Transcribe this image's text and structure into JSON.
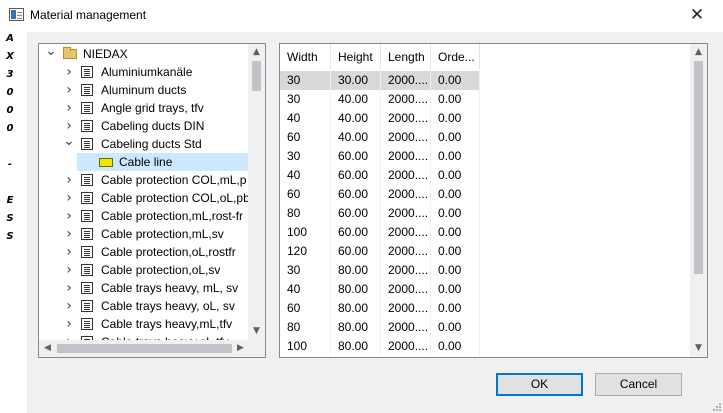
{
  "window": {
    "title": "Material management",
    "close_glyph": "✕",
    "title_icon": "window-app-icon"
  },
  "side_strip": {
    "chars": [
      "A",
      "X",
      "3",
      "0",
      "0",
      "0",
      "",
      "-",
      "",
      "E",
      "S",
      "S"
    ]
  },
  "tree": {
    "items": [
      {
        "label": "NIEDAX",
        "level": 0,
        "expander": "v",
        "icon": "folder-icon"
      },
      {
        "label": "Aluminiumkanäle",
        "level": 1,
        "expander": ">",
        "icon": "document-list-icon"
      },
      {
        "label": "Aluminum ducts",
        "level": 1,
        "expander": ">",
        "icon": "document-list-icon"
      },
      {
        "label": "Angle grid trays, tfv",
        "level": 1,
        "expander": ">",
        "icon": "document-list-icon"
      },
      {
        "label": "Cabeling ducts DIN",
        "level": 1,
        "expander": ">",
        "icon": "document-list-icon"
      },
      {
        "label": "Cabeling ducts Std",
        "level": 1,
        "expander": "v",
        "icon": "document-list-icon"
      },
      {
        "label": "Cable line",
        "level": 2,
        "expander": "",
        "icon": "cable-line-icon",
        "selected": true
      },
      {
        "label": "Cable protection COL,mL,p",
        "level": 1,
        "expander": ">",
        "icon": "document-list-icon"
      },
      {
        "label": "Cable protection COL,oL,pb",
        "level": 1,
        "expander": ">",
        "icon": "document-list-icon"
      },
      {
        "label": "Cable protection,mL,rost-fr",
        "level": 1,
        "expander": ">",
        "icon": "document-list-icon"
      },
      {
        "label": "Cable protection,mL,sv",
        "level": 1,
        "expander": ">",
        "icon": "document-list-icon"
      },
      {
        "label": "Cable protection,oL,rostfr",
        "level": 1,
        "expander": ">",
        "icon": "document-list-icon"
      },
      {
        "label": "Cable protection,oL,sv",
        "level": 1,
        "expander": ">",
        "icon": "document-list-icon"
      },
      {
        "label": "Cable trays heavy, mL, sv",
        "level": 1,
        "expander": ">",
        "icon": "document-list-icon"
      },
      {
        "label": "Cable trays heavy, oL, sv",
        "level": 1,
        "expander": ">",
        "icon": "document-list-icon"
      },
      {
        "label": "Cable trays heavy,mL,tfv",
        "level": 1,
        "expander": ">",
        "icon": "document-list-icon"
      },
      {
        "label": "Cable trays heavy,oL,tfv",
        "level": 1,
        "expander": ">",
        "icon": "document-list-icon"
      }
    ],
    "scroll_up": "▲",
    "scroll_down": "▼",
    "scroll_left": "◀",
    "scroll_right": "▶"
  },
  "grid": {
    "columns": [
      "Width",
      "Height",
      "Length",
      "Orde..."
    ],
    "rows": [
      [
        "30",
        "30.00",
        "2000....",
        "0.00"
      ],
      [
        "30",
        "40.00",
        "2000....",
        "0.00"
      ],
      [
        "40",
        "40.00",
        "2000....",
        "0.00"
      ],
      [
        "60",
        "40.00",
        "2000....",
        "0.00"
      ],
      [
        "30",
        "60.00",
        "2000....",
        "0.00"
      ],
      [
        "40",
        "60.00",
        "2000....",
        "0.00"
      ],
      [
        "60",
        "60.00",
        "2000....",
        "0.00"
      ],
      [
        "80",
        "60.00",
        "2000....",
        "0.00"
      ],
      [
        "100",
        "60.00",
        "2000....",
        "0.00"
      ],
      [
        "120",
        "60.00",
        "2000....",
        "0.00"
      ],
      [
        "30",
        "80.00",
        "2000....",
        "0.00"
      ],
      [
        "40",
        "80.00",
        "2000....",
        "0.00"
      ],
      [
        "60",
        "80.00",
        "2000....",
        "0.00"
      ],
      [
        "80",
        "80.00",
        "2000....",
        "0.00"
      ],
      [
        "100",
        "80.00",
        "2000....",
        "0.00"
      ]
    ],
    "selected_row": 0,
    "scroll_up": "▲",
    "scroll_down": "▼"
  },
  "buttons": {
    "ok": "OK",
    "cancel": "Cancel"
  },
  "colors": {
    "selection_tree": "#cce8ff",
    "selection_grid": "#d9d9d9",
    "default_button_border": "#0078d7"
  }
}
